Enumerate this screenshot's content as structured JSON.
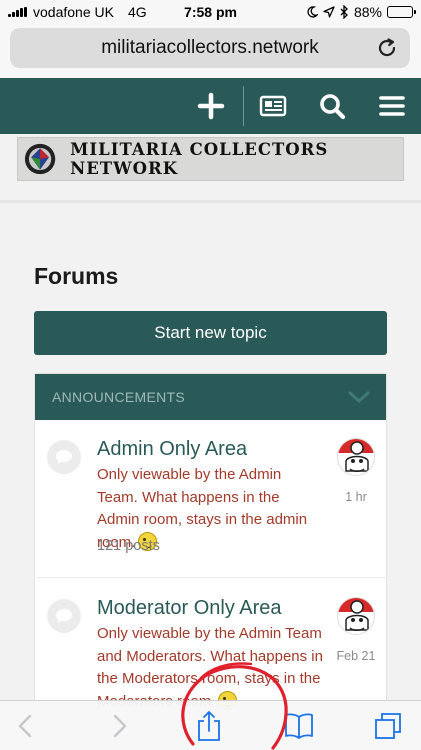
{
  "status_bar": {
    "carrier": "vodafone UK",
    "network": "4G",
    "time": "7:58 pm",
    "battery": "88%",
    "battery_level": 0.88,
    "icons": [
      "signal-icon",
      "moon-icon",
      "location-icon",
      "bluetooth-icon",
      "battery-icon"
    ]
  },
  "browser": {
    "url": "militariacollectors.network",
    "icons": [
      "reload-icon"
    ]
  },
  "site_header": {
    "icons": [
      "plus-icon",
      "news-icon",
      "search-icon",
      "menu-icon"
    ],
    "background": "#2a5a58"
  },
  "banner": {
    "title": "MILITARIA COLLECTORS NETWORK"
  },
  "page": {
    "title": "Forums",
    "start_button": "Start new topic"
  },
  "category": {
    "name": "ANNOUNCEMENTS",
    "forums": [
      {
        "title": "Admin Only Area",
        "description": "Only viewable by the Admin Team. What happens in the Admin room, stays in the admin room.",
        "posts": "121 posts",
        "last_post_time": "1 hr"
      },
      {
        "title": "Moderator Only Area",
        "description": "Only viewable by the Admin Team and Moderators. What happens in the Moderators room, stays in the Moderators room.",
        "last_post_time": "Feb 21"
      }
    ]
  },
  "toolbar": {
    "icons": [
      "back-icon",
      "forward-icon",
      "share-icon",
      "bookmarks-icon",
      "tabs-icon"
    ]
  },
  "colors": {
    "accent": "#2a5a58",
    "description_text": "#a33a2a",
    "annotation": "#e0202c"
  }
}
